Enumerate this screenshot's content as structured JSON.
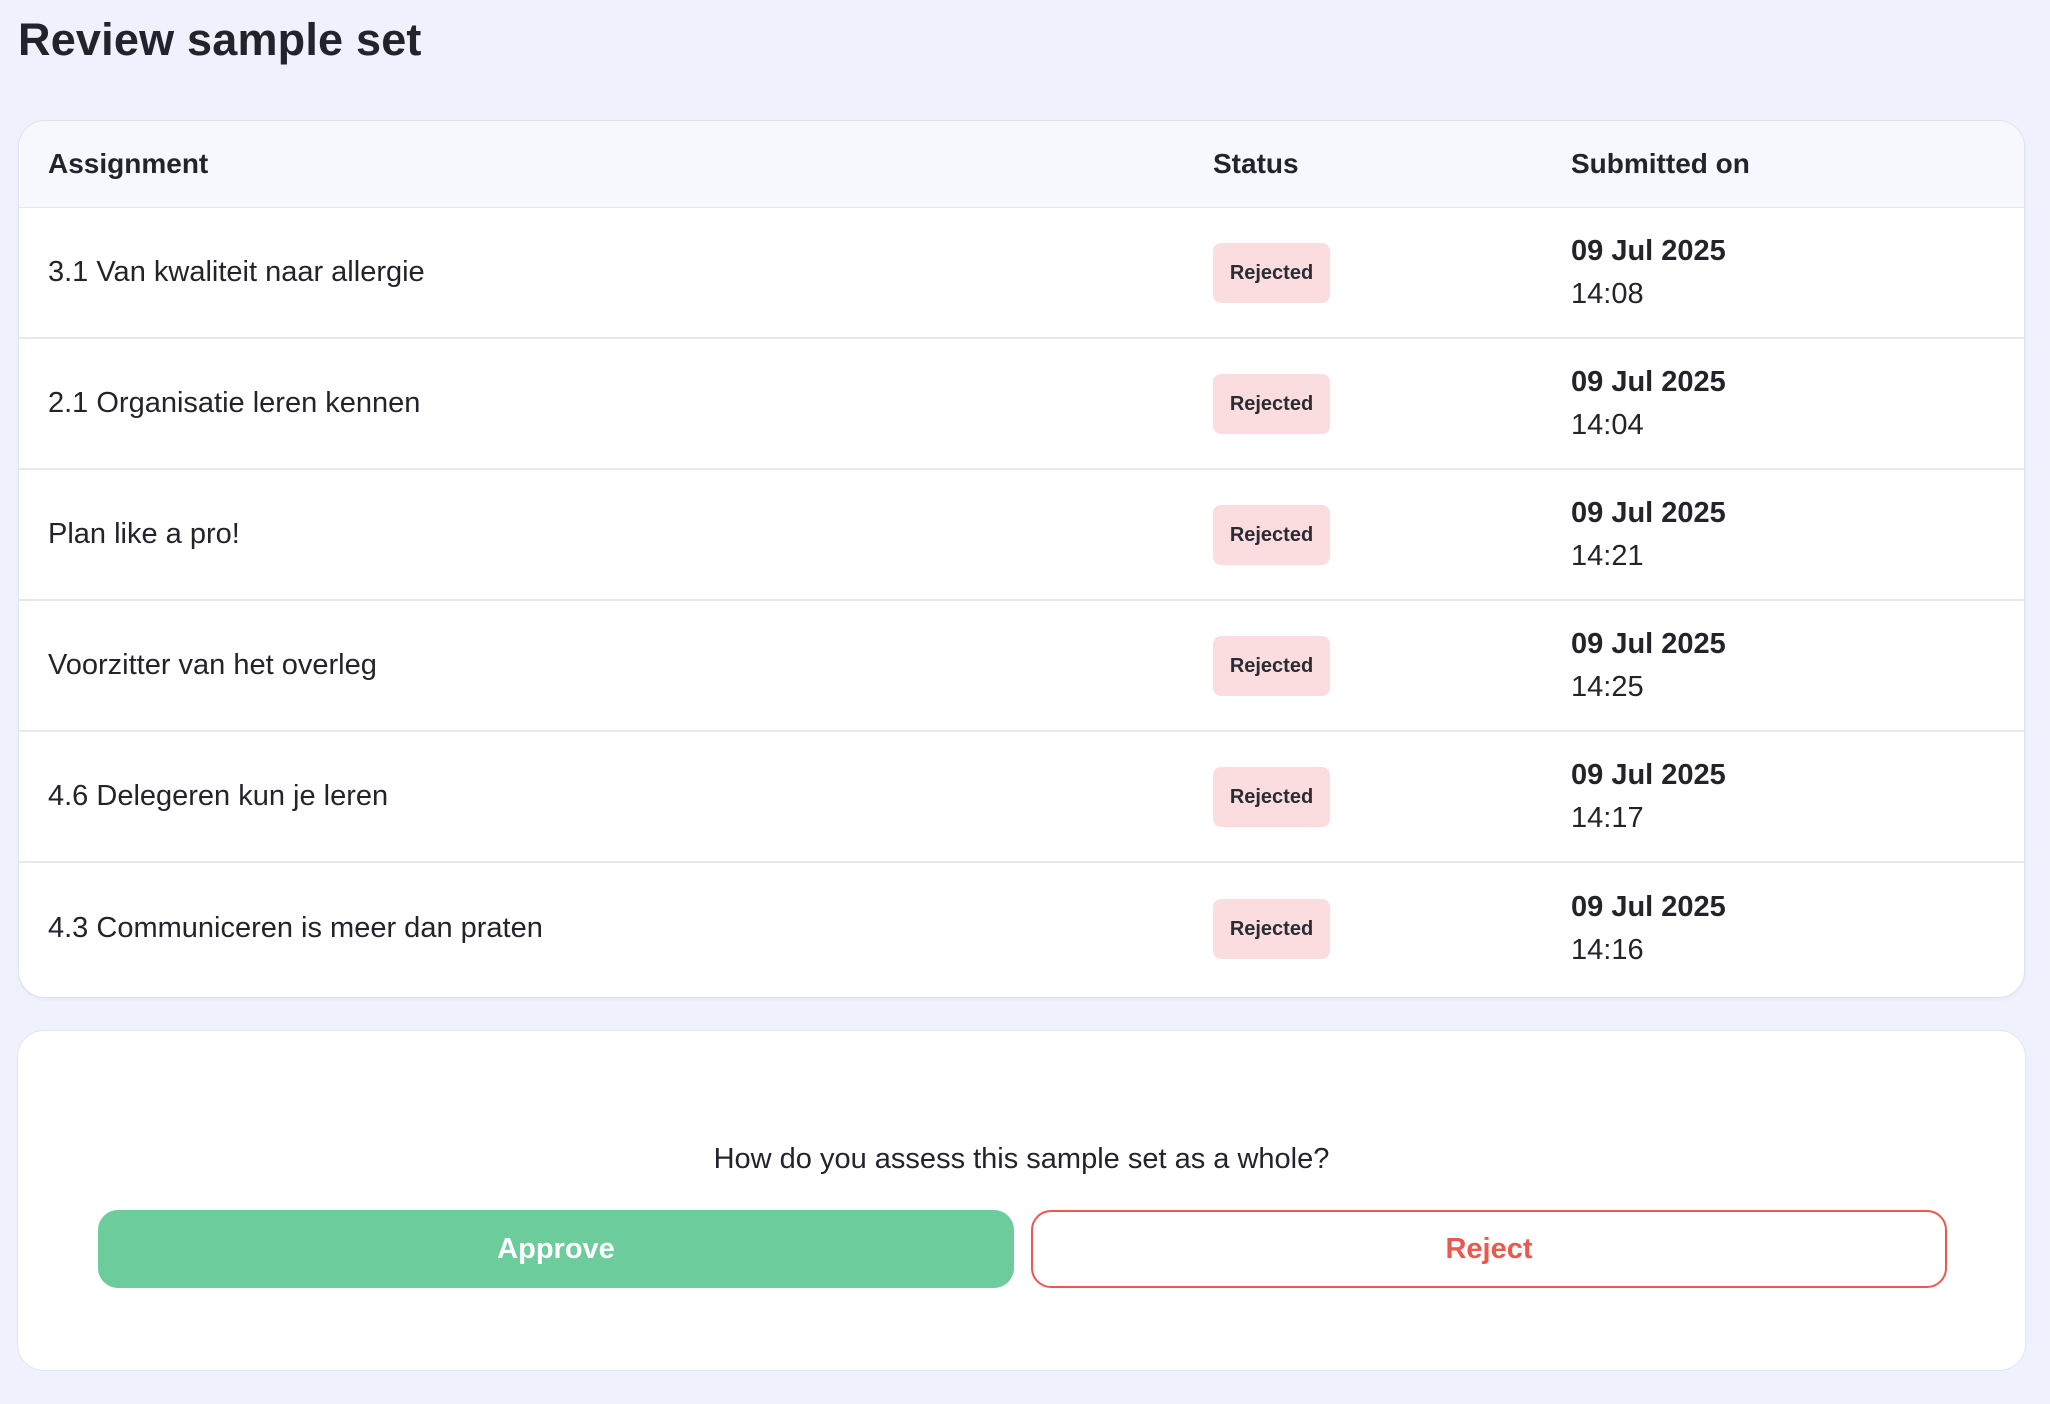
{
  "page": {
    "title": "Review sample set"
  },
  "table": {
    "headers": {
      "assignment": "Assignment",
      "status": "Status",
      "submitted_on": "Submitted on"
    },
    "rows": [
      {
        "assignment": "3.1 Van kwaliteit naar allergie",
        "status": "Rejected",
        "date": "09 Jul 2025",
        "time": "14:08"
      },
      {
        "assignment": "2.1 Organisatie leren kennen",
        "status": "Rejected",
        "date": "09 Jul 2025",
        "time": "14:04"
      },
      {
        "assignment": "Plan like a pro!",
        "status": "Rejected",
        "date": "09 Jul 2025",
        "time": "14:21"
      },
      {
        "assignment": "Voorzitter van het overleg",
        "status": "Rejected",
        "date": "09 Jul 2025",
        "time": "14:25"
      },
      {
        "assignment": "4.6 Delegeren kun je leren",
        "status": "Rejected",
        "date": "09 Jul 2025",
        "time": "14:17"
      },
      {
        "assignment": "4.3 Communiceren is meer dan praten",
        "status": "Rejected",
        "date": "09 Jul 2025",
        "time": "14:16"
      }
    ]
  },
  "assessment": {
    "question": "How do you assess this sample set as a whole?",
    "approve_label": "Approve",
    "reject_label": "Reject"
  },
  "colors": {
    "background": "#eff1fd",
    "approve": "#6ccc9c",
    "reject": "#e85a4f",
    "rejected_badge": "#fbdde0"
  }
}
